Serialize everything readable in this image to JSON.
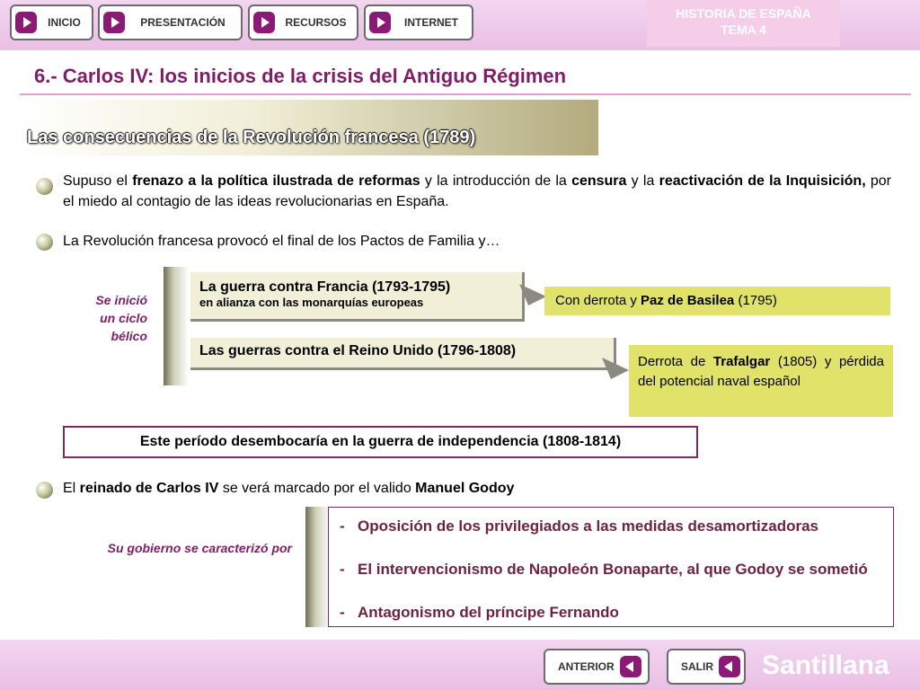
{
  "nav": {
    "inicio": "INICIO",
    "presentacion": "PRESENTACIÓN",
    "recursos": "RECURSOS",
    "internet": "INTERNET"
  },
  "topic": {
    "line1": "HISTORIA DE ESPAÑA",
    "line2": "TEMA 4"
  },
  "page_title": "6.- Carlos IV: los inicios de la crisis del Antiguo Régimen",
  "section_title": "Las consecuencias de la Revolución francesa (1789)",
  "para1": {
    "a": "Supuso el ",
    "b": "frenazo a la política ilustrada de reformas",
    "c": " y la introducción de la ",
    "d": "censura",
    "e": " y la ",
    "f": "reactivación de la Inquisición,",
    "g": " por el miedo al contagio de las ideas revolucionarias en España."
  },
  "para2": "La Revolución francesa provocó el final de los Pactos de Familia y…",
  "side_note_1": {
    "l1": "Se inició",
    "l2": "un ciclo",
    "l3": "bélico"
  },
  "war1": {
    "title": "La guerra contra Francia (1793-1795)",
    "sub": "en alianza con las monarquías europeas"
  },
  "war1_result": {
    "a": "Con derrota y ",
    "b": "Paz de Basilea",
    "c": " (1795)"
  },
  "war2": {
    "title": "Las guerras contra el Reino Unido (1796-1808)"
  },
  "war2_result": {
    "a": "Derrota de ",
    "b": "Trafalgar",
    "c": " (1805) y pérdida del potencial naval español"
  },
  "framed_text": "Este período desembocaría en la guerra de independencia (1808-1814)",
  "para3": {
    "a": "El ",
    "b": "reinado de Carlos IV",
    "c": " se verá marcado por el valido ",
    "d": "Manuel Godoy"
  },
  "side_note_2": "Su gobierno se caracterizó por",
  "list": [
    {
      "dash": "-",
      "text": "Oposición de los privilegiados a las medidas desamortizadoras"
    },
    {
      "dash": "-",
      "text": "El intervencionismo de Napoleón Bonaparte, al que Godoy se sometió"
    },
    {
      "dash": "-",
      "text": "Antagonismo del príncipe Fernando"
    }
  ],
  "footer": {
    "anterior": "ANTERIOR",
    "salir": "SALIR",
    "brand": "Santillana"
  },
  "colors": {
    "accent": "#7d1e66",
    "button_arrow": "#8a1a76",
    "highlight": "#e0e26a",
    "bar": "#e9bfe5"
  }
}
